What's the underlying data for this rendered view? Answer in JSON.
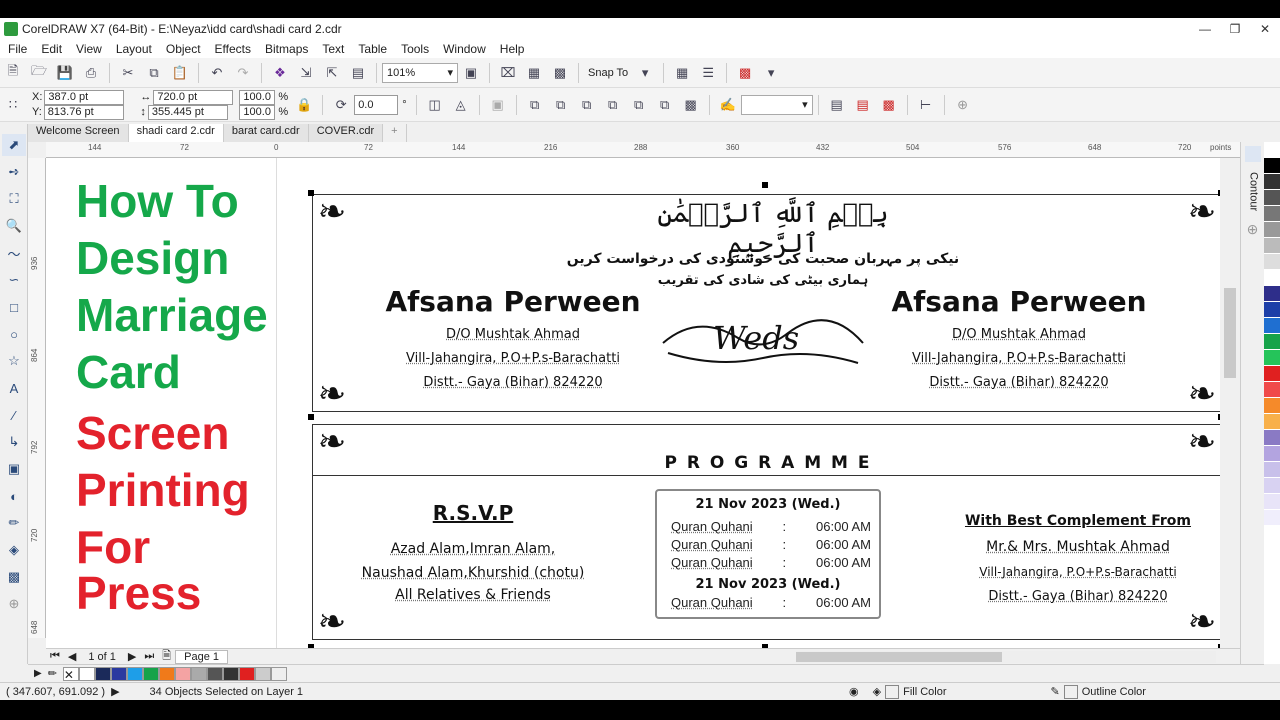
{
  "window": {
    "title": "CorelDRAW X7 (64-Bit) - E:\\Neyaz\\idd card\\shadi card 2.cdr"
  },
  "menu": [
    "File",
    "Edit",
    "View",
    "Layout",
    "Object",
    "Effects",
    "Bitmaps",
    "Text",
    "Table",
    "Tools",
    "Window",
    "Help"
  ],
  "toolbar1": {
    "zoom": "101%",
    "snap_to": "Snap To"
  },
  "toolbar2": {
    "x_label": "X:",
    "x_value": "387.0 pt",
    "y_label": "Y:",
    "y_value": "813.76 pt",
    "w_value": "720.0 pt",
    "h_value": "355.445 pt",
    "scale_w": "100.0",
    "scale_h": "100.0",
    "pct": "%",
    "rotation": "0.0",
    "deg": "°"
  },
  "doc_tabs": [
    "Welcome Screen",
    "shadi card 2.cdr",
    "barat card.cdr",
    "COVER.cdr"
  ],
  "ruler_h": [
    "144",
    "72",
    "0",
    "72",
    "144",
    "216",
    "288",
    "360",
    "432",
    "504",
    "576",
    "648",
    "720"
  ],
  "ruler_h_unit": "points",
  "ruler_v": [
    "936",
    "864",
    "792",
    "720",
    "648"
  ],
  "ruler_v_unit": "points",
  "overlay": {
    "line1": "How To",
    "line2": "Design",
    "line3": "Marriage",
    "line4": "Card",
    "line5": "Screen",
    "line6": "Printing",
    "line7": "For Press"
  },
  "card": {
    "bismillah": "بِسۡمِ ٱللَّهِ ٱلرَّحۡمَٰنِ ٱلرَّحِيمِ",
    "urdu_line1": "نیکی پر مہربان صحبت کی خوشنودی کی درخواست کریں",
    "urdu_line2": "ہماری بیٹی کی شادی کی تقریب",
    "left_name": "Afsana Perween",
    "left_parent": "D/O Mushtak Ahmad",
    "left_addr1": "Vill-Jahangira, P.O+P.s-Barachatti",
    "left_addr2": "Distt.- Gaya (Bihar) 824220",
    "weds": "Weds",
    "right_name": "Afsana Perween",
    "right_parent": "D/O Mushtak Ahmad",
    "right_addr1": "Vill-Jahangira, P.O+P.s-Barachatti",
    "right_addr2": "Distt.- Gaya (Bihar) 824220",
    "programme": "P R O G R A M M E",
    "rsvp": "R.S.V.P",
    "rsvp_line1": "Azad Alam,Imran Alam,",
    "rsvp_line2": "Naushad Alam,Khurshid (chotu)",
    "rsvp_line3": "All Relatives & Friends",
    "date1": "21 Nov 2023 (Wed.)",
    "event_rows": [
      {
        "name": "Quran Quhani",
        "sep": ":",
        "time": "06:00 AM"
      },
      {
        "name": "Quran Quhani",
        "sep": ":",
        "time": "06:00 AM"
      },
      {
        "name": "Quran Quhani",
        "sep": ":",
        "time": "06:00 AM"
      }
    ],
    "date2": "21 Nov 2023 (Wed.)",
    "event_row_last": {
      "name": "Quran Quhani",
      "sep": ":",
      "time": "06:00 AM"
    },
    "compliment_title": "With Best Complement From",
    "compliment_line1": "Mr.& Mrs. Mushtak Ahmad",
    "compliment_line2": "Vill-Jahangira, P.O+P.s-Barachatti",
    "compliment_line3": "Distt.- Gaya (Bihar) 824220"
  },
  "pagebar": {
    "page_count": "1 of 1",
    "page_tab": "Page 1"
  },
  "dockers": {
    "contour": "Contour"
  },
  "status": {
    "coords": "( 347.607, 691.092 )",
    "selection": "34 Objects Selected on Layer 1",
    "fill": "Fill Color",
    "outline": "Outline Color"
  },
  "palette_colors": [
    "#ffffff",
    "#000000",
    "#333333",
    "#555555",
    "#777777",
    "#999999",
    "#bbbbbb",
    "#dddddd",
    "#ffffff",
    "#2e2e8a",
    "#1d3fa8",
    "#1f6fd1",
    "#16a34a",
    "#25c45a",
    "#e02020",
    "#f04a4a",
    "#f58a2a",
    "#f8b04a",
    "#8a7ac4",
    "#b3a4e0",
    "#c8c0ea",
    "#d8d2f2",
    "#e8e4f8",
    "#f0eefc"
  ],
  "doc_palette_colors": [
    "#ffffff",
    "#1b2a5a",
    "#2b3aa0",
    "#1e9ee8",
    "#16a34a",
    "#f07a1a",
    "#f4a3a3",
    "#aaaaaa",
    "#555555",
    "#333333",
    "#e02020",
    "#cccccc",
    "#eeeeee"
  ]
}
